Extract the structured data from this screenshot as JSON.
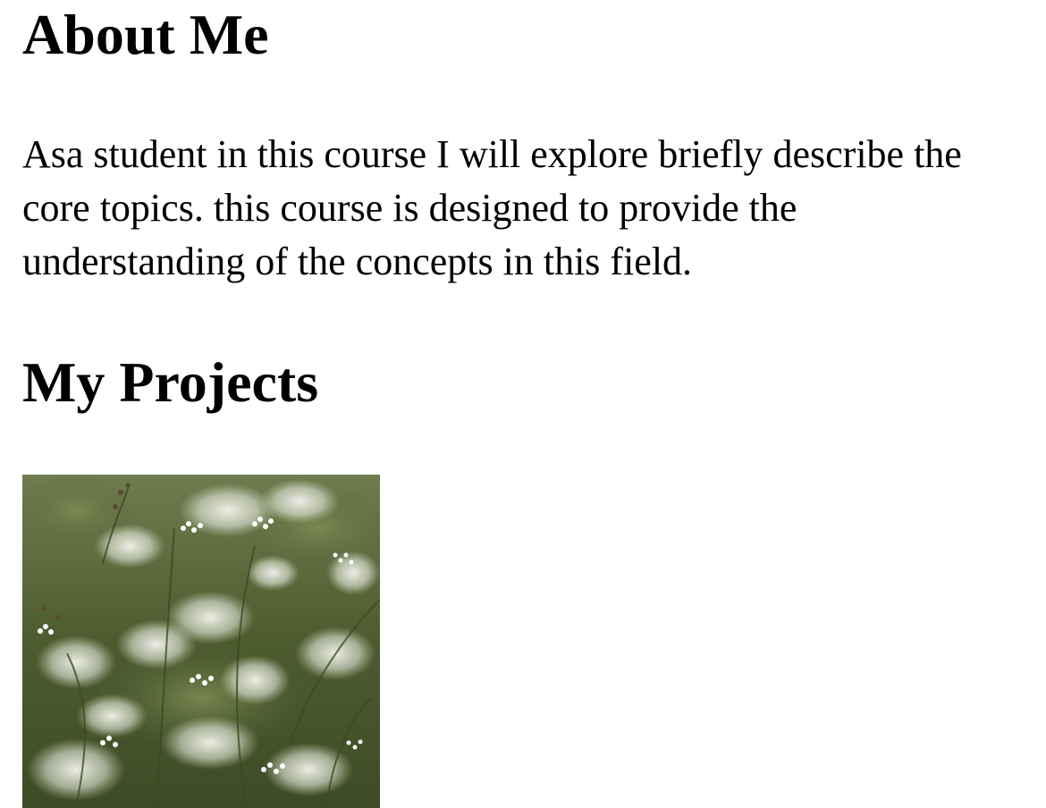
{
  "about": {
    "heading": "About Me",
    "text": "Asa student in this course I will explore briefly describe the core topics. this course is designed to provide the understanding of the concepts in this field."
  },
  "projects": {
    "heading": "My Projects",
    "image": "flowers-photo"
  },
  "colors": {
    "text": "#000000",
    "background": "#ffffff",
    "photo_green": "#4f5d33",
    "photo_flower": "#f3f4ee"
  }
}
